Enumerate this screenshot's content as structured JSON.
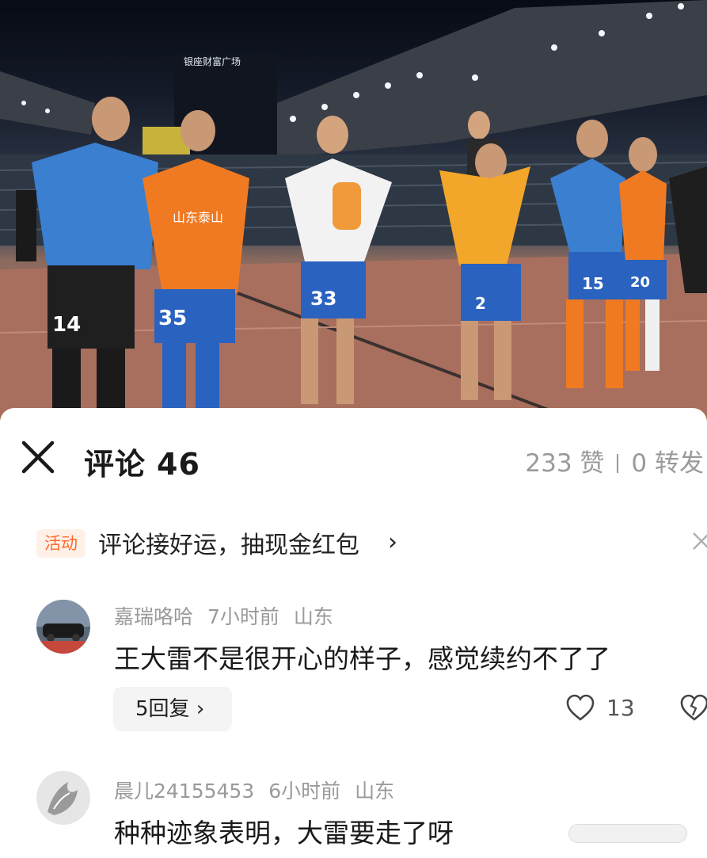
{
  "photo": {
    "description_alt": "photo",
    "jersey_numbers": [
      "14",
      "35",
      "33",
      "2",
      "15",
      "20"
    ],
    "sponsor_text": "山东泰山",
    "billboard_text": "银座财富广场"
  },
  "header": {
    "title": "评论",
    "comment_count": "46",
    "likes": "233 赞",
    "shares": "0 转发"
  },
  "promo": {
    "badge": "活动",
    "text": "评论接好运，抽现金红包",
    "chevron": "›"
  },
  "comments": [
    {
      "username": "嘉瑞咯哈",
      "time": "7小时前",
      "location": "山东",
      "text": "王大雷不是很开心的样子，感觉续约不了了",
      "replies_label": "5回复",
      "likes": "13"
    },
    {
      "username": "晨儿24155453",
      "time": "6小时前",
      "location": "山东",
      "text": "种种迹象表明，大雷要走了呀"
    }
  ],
  "colors": {
    "accent": "#ff6a2e",
    "badge_bg": "#fff1e8",
    "muted": "#9a9a9a",
    "reply_bg": "#f4f4f4",
    "orange_kit": "#f07a22",
    "blue_kit": "#2a6fc9"
  },
  "icons": {
    "close": "close-icon",
    "promo_close": "close-small-icon",
    "like": "heart-icon",
    "dislike": "broken-heart-icon"
  }
}
